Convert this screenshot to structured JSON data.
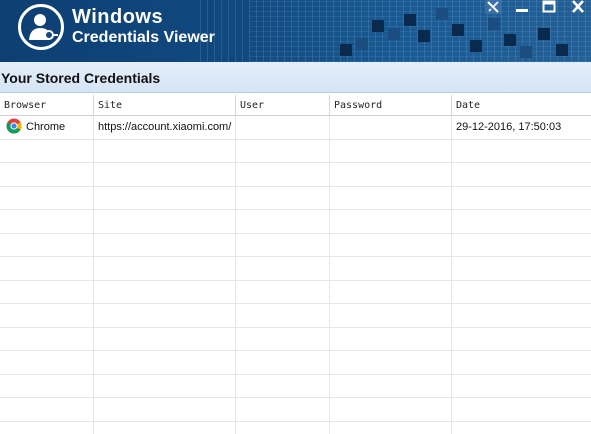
{
  "app": {
    "title_line1": "Windows",
    "title_line2": "Credentials Viewer"
  },
  "titlebar": {
    "buttons": [
      "tools-icon",
      "minimize-icon",
      "maximize-icon",
      "close-icon"
    ]
  },
  "section": {
    "heading": "Your Stored Credentials"
  },
  "table": {
    "columns": [
      "Browser",
      "Site",
      "User",
      "Password",
      "Date"
    ],
    "rows": [
      {
        "browser": "Chrome",
        "browser_icon": "chrome-icon",
        "site": "https://account.xiaomi.com/",
        "user": "",
        "password": "",
        "date": "29-12-2016, 17:50:03"
      }
    ],
    "empty_row_count": 13
  },
  "colors": {
    "banner": "#11497f",
    "section_bg": "#d5e5f6"
  }
}
